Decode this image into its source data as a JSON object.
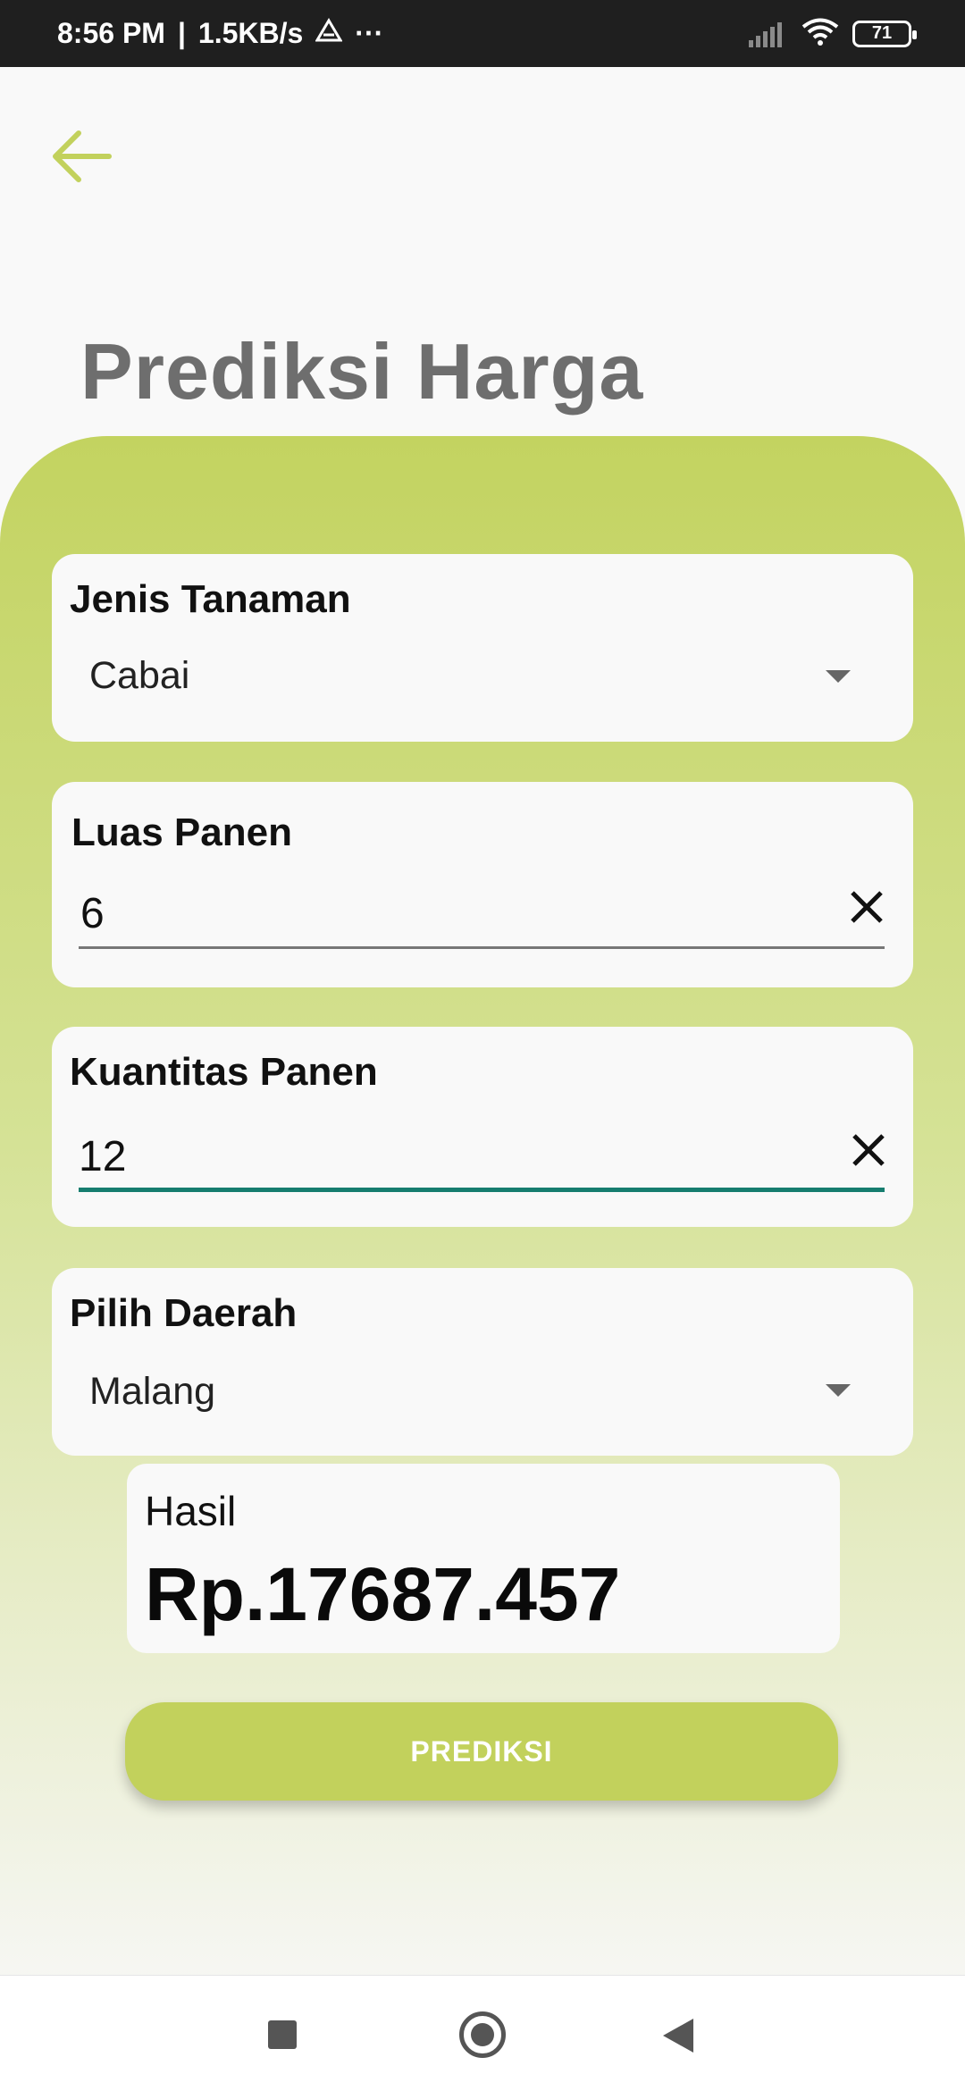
{
  "status_bar": {
    "time": "8:56 PM",
    "speed": "1.5KB/s",
    "more": "···",
    "battery": "71"
  },
  "page": {
    "title": "Prediksi Harga"
  },
  "form": {
    "plant_type": {
      "label": "Jenis Tanaman",
      "value": "Cabai"
    },
    "harvest_area": {
      "label": "Luas Panen",
      "value": "6"
    },
    "harvest_quantity": {
      "label": "Kuantitas Panen",
      "value": "12"
    },
    "region": {
      "label": "Pilih Daerah",
      "value": "Malang"
    }
  },
  "result": {
    "label": "Hasil",
    "value": "Rp.17687.457"
  },
  "actions": {
    "predict_label": "PREDIKSI"
  },
  "colors": {
    "accent": "#c2d15c",
    "focus_underline": "#167d6f",
    "title": "#6e6e6e"
  }
}
